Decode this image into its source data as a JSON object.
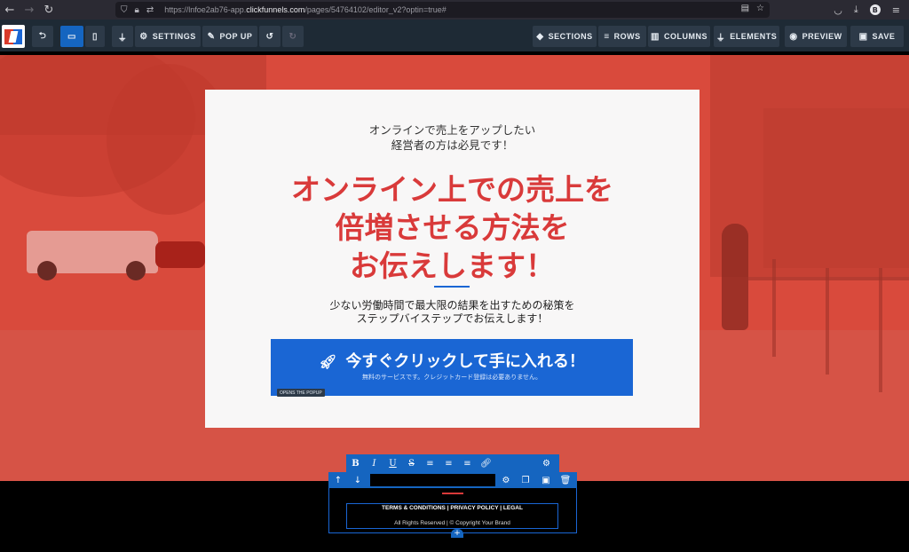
{
  "browser": {
    "url_prefix": "https://lnfoe2ab76-app.",
    "url_domain": "clickfunnels.com",
    "url_path": "/pages/54764102/editor_v2?optin=true#",
    "profile_initial": "B",
    "icons": [
      "back-icon",
      "forward-icon",
      "reload-icon",
      "shield-icon",
      "lock-icon",
      "reader-icon",
      "star-icon",
      "pocket-icon",
      "download-icon",
      "menu-icon"
    ]
  },
  "toolbar": {
    "settings": "SETTINGS",
    "popup": "POP UP",
    "sections": "SECTIONS",
    "rows": "ROWS",
    "columns": "COLUMNS",
    "elements": "ELEMENTS",
    "preview": "PREVIEW",
    "save": "SAVE"
  },
  "card": {
    "pre_line1": "オンラインで売上をアップしたい",
    "pre_line2": "経営者の方は必見です！",
    "headline_line1": "オンライン上での売上を",
    "headline_line2": "倍増させる方法を",
    "headline_line3": "お伝えします！",
    "sub_line1": "少ない労働時間で最大限の結果を出すための秘策を",
    "sub_line2": "ステップバイステップでお伝えします！",
    "cta_main": "今すぐクリックして手に入れる！",
    "cta_sub": "無料のサービスです。クレジットカード登録は必要ありません。",
    "cta_tag": "OPENS THE POPUP"
  },
  "footer": {
    "links": "TERMS & CONDITIONS  |  PRIVACY POLICY  |  LEGAL",
    "copyright": "All Rights Reserved | © Copyright Your Brand"
  },
  "colors": {
    "accent": "#1565c0",
    "headline": "#d93a3a",
    "toolbar_bg": "#1e2a35",
    "canvas_bg": "#d94a3c"
  }
}
